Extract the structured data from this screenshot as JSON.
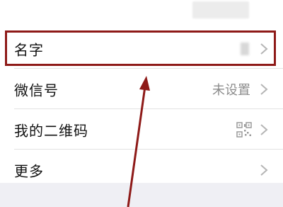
{
  "rows": [
    {
      "label": "名字",
      "value": "",
      "icon": "chevron-right-icon"
    },
    {
      "label": "微信号",
      "value": "未设置",
      "icon": "chevron-right-icon"
    },
    {
      "label": "我的二维码",
      "value": "",
      "value_icon": "qr-code-icon",
      "icon": "chevron-right-icon"
    },
    {
      "label": "更多",
      "value": "",
      "icon": "chevron-right-icon"
    }
  ],
  "colors": {
    "highlight": "#8e1a18",
    "arrow": "#8e1a18",
    "value_text": "#8c8c8c",
    "separator": "#e3e3e3",
    "footer_band": "#efeff4"
  }
}
